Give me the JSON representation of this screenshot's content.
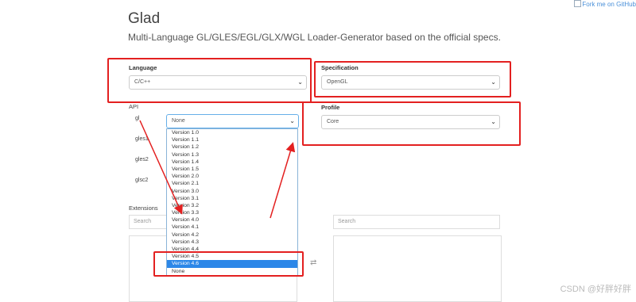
{
  "fork_link": "Fork me on GitHub",
  "header": {
    "title": "Glad",
    "subtitle": "Multi-Language GL/GLES/EGL/GLX/WGL Loader-Generator based on the official specs."
  },
  "language": {
    "label": "Language",
    "value": "C/C++"
  },
  "specification": {
    "label": "Specification",
    "value": "OpenGL"
  },
  "profile": {
    "label": "Profile",
    "value": "Core"
  },
  "api": {
    "label": "API",
    "rows": [
      {
        "name": "gl",
        "value": "None"
      },
      {
        "name": "gles1"
      },
      {
        "name": "gles2"
      },
      {
        "name": "glsc2"
      }
    ],
    "dropdown_options": [
      "Version 1.0",
      "Version 1.1",
      "Version 1.2",
      "Version 1.3",
      "Version 1.4",
      "Version 1.5",
      "Version 2.0",
      "Version 2.1",
      "Version 3.0",
      "Version 3.1",
      "Version 3.2",
      "Version 3.3",
      "Version 4.0",
      "Version 4.1",
      "Version 4.2",
      "Version 4.3",
      "Version 4.4",
      "Version 4.5",
      "Version 4.6",
      "None"
    ],
    "dropdown_selected": "Version 4.6"
  },
  "extensions": {
    "label": "Extensions",
    "left_search_placeholder": "Search",
    "right_search_placeholder": "Search"
  },
  "icons": {
    "chevron": "chevron-down-icon",
    "swap": "swap-arrows-icon"
  },
  "annotation_color": "#e32020",
  "selection_color": "#2c87e8",
  "watermark": "CSDN @好胖好胖"
}
